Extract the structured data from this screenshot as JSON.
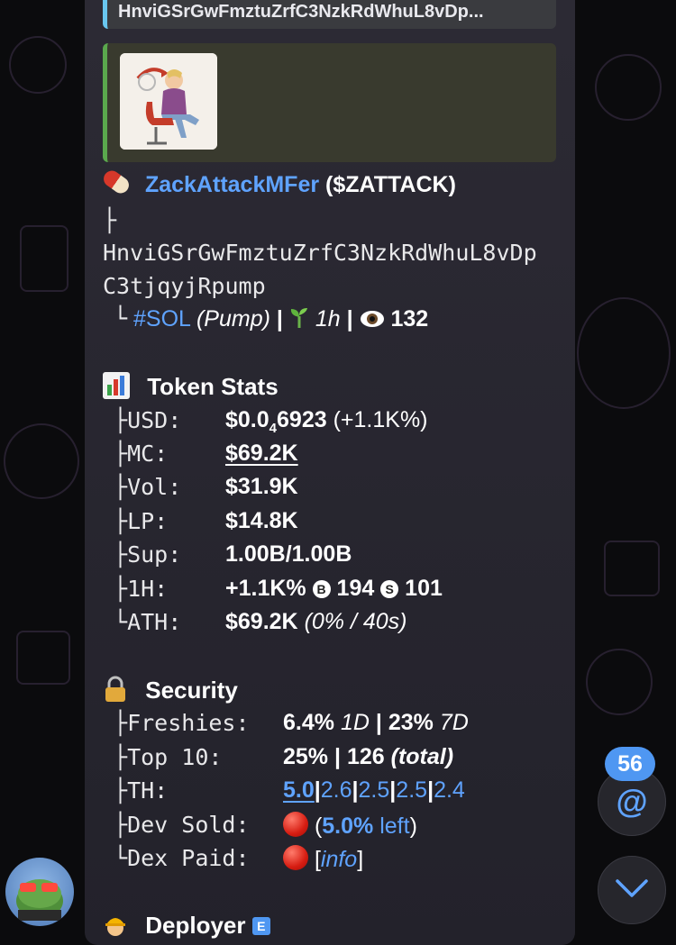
{
  "message": {
    "quote_top": "HnviGSrGwFmztuZrfC3NzkRdWhuL8vDp...",
    "token_name": "ZackAttackMFer",
    "token_ticker": "($ZATTACK)",
    "tree_branch": "├",
    "address_line1": "HnviGSrGwFmztuZrfC3NzkRdWhuL8vDp",
    "address_line2": "C3tjqyjRpump",
    "tree_end": "└",
    "chain_tag": "#SOL",
    "platform": "(Pump)",
    "sep": "|",
    "age": "1h",
    "views": "132",
    "stats": {
      "title": "Token Stats",
      "rows": [
        {
          "branch": "├",
          "label": "USD:",
          "value_prefix": "$0.0",
          "value_sub": "4",
          "value_main": "6923",
          "value_extra": "(+1.1K%)"
        },
        {
          "branch": "├",
          "label": "MC:",
          "value": "$69.2K"
        },
        {
          "branch": "├",
          "label": "Vol:",
          "value": "$31.9K"
        },
        {
          "branch": "├",
          "label": "LP:",
          "value": "$14.8K"
        },
        {
          "branch": "├",
          "label": "Sup:",
          "value": "1.00B/1.00B"
        },
        {
          "branch": "├",
          "label": "1H:",
          "value": "+1.1K%",
          "buys_icon": "B",
          "buys": "194",
          "sells_icon": "S",
          "sells": "101"
        },
        {
          "branch": "└",
          "label": "ATH:",
          "value": "$69.2K",
          "value_extra": "(0% / 40s)"
        }
      ]
    },
    "security": {
      "title": "Security",
      "rows": [
        {
          "branch": "├",
          "label": "Freshies:",
          "v1": "6.4%",
          "v1i": "1D",
          "sep": "|",
          "v2": "23%",
          "v2i": "7D"
        },
        {
          "branch": "├",
          "label": "Top 10:",
          "v1": "25%",
          "sep": "|",
          "v2": "126",
          "v2i": "(total)"
        },
        {
          "branch": "├",
          "label": "TH:",
          "holders": [
            "5.0",
            "2.6",
            "2.5",
            "2.5",
            "2.4"
          ],
          "sep": "|"
        },
        {
          "branch": "├",
          "label": "Dev Sold:",
          "open": "(",
          "pct": "5.0%",
          "left": "left",
          "close": ")"
        },
        {
          "branch": "└",
          "label": "Dex Paid:",
          "info_open": "[",
          "info": "info",
          "info_close": "]"
        }
      ]
    },
    "deployer_title": "Deployer",
    "deployer_badge": "E"
  },
  "mentions_badge": "56",
  "colors": {
    "link": "#5fa3ff",
    "accent_blue": "#4f97f2",
    "quote_bar": "#69c7f0",
    "preview_bar": "#5aa84d",
    "red_dot": "#d61d12"
  },
  "icons": [
    "pill-icon",
    "sprout-icon",
    "eye-icon",
    "bar-chart-icon",
    "lock-icon",
    "worker-icon",
    "red-circle-icon",
    "at-icon",
    "chevron-down-icon"
  ]
}
